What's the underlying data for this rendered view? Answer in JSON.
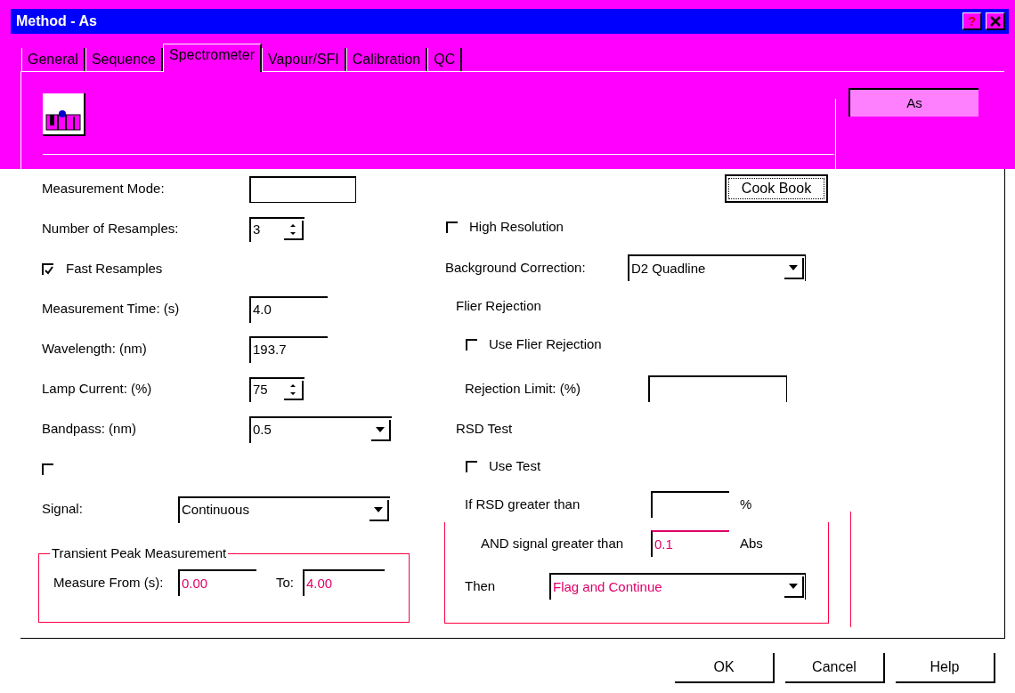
{
  "window": {
    "title": "Method - As",
    "help_button": "?"
  },
  "tabs": [
    {
      "label": "General",
      "selected": false
    },
    {
      "label": "Sequence",
      "selected": false
    },
    {
      "label": "Spectrometer",
      "selected": true
    },
    {
      "label": "Vapour/SFI",
      "selected": false
    },
    {
      "label": "Calibration",
      "selected": false
    },
    {
      "label": "QC",
      "selected": false
    }
  ],
  "element_button": {
    "label": "As"
  },
  "left_fields": [
    {
      "kind": "text",
      "label": "Measurement Mode:"
    },
    {
      "kind": "spin",
      "label": "Number of Resamples:",
      "value": "3"
    },
    {
      "kind": "checkbox",
      "label": "Fast Resamples",
      "checked": true
    },
    {
      "kind": "text",
      "label": "Measurement Time: (s)",
      "value": "4.0"
    },
    {
      "kind": "text",
      "label": "Wavelength: (nm)",
      "value": "193.7"
    },
    {
      "kind": "spin",
      "label": "Lamp Current: (%)",
      "value": "75"
    },
    {
      "kind": "dropdown",
      "label": "Bandpass: (nm)",
      "value": "0.5"
    },
    {
      "kind": "checkbox",
      "checked": false
    },
    {
      "kind": "long_dropdown",
      "label": "Signal:",
      "value": "Continuous"
    }
  ],
  "transient_group": {
    "title": "Transient Peak Measurement",
    "from_label": "Measure From (s):",
    "from_value": "0.00",
    "to_label": "To:",
    "to_value": "4.00"
  },
  "cook_book_button": "Cook Book",
  "right_fields": [
    {
      "kind": "checkbox",
      "label": "High Resolution",
      "checked": false
    },
    {
      "kind": "dropdown",
      "label": "Background Correction:",
      "value": "D2 Quadline"
    },
    {
      "kind": "heading",
      "label": "Flier Rejection"
    },
    {
      "kind": "checkbox",
      "label": "Use Flier Rejection",
      "checked": false
    },
    {
      "kind": "text",
      "label": "Rejection Limit: (%)"
    },
    {
      "kind": "heading",
      "label": "RSD Test"
    },
    {
      "kind": "checkbox",
      "label": "Use Test",
      "checked": false
    },
    {
      "kind": "text",
      "label": "If RSD greater than",
      "unit": "%"
    }
  ],
  "rsd_group": [
    {
      "kind": "text",
      "label": "AND signal greater than",
      "value": "0.1",
      "unit": "Abs"
    },
    {
      "kind": "dropdown",
      "label": "Then",
      "value": "Flag and Continue"
    }
  ],
  "buttons": [
    "OK",
    "Cancel",
    "Help"
  ]
}
